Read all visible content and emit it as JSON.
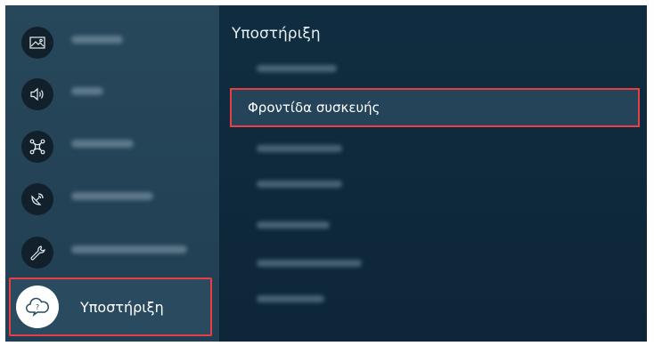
{
  "sidebar": {
    "items": [
      {
        "icon": "picture-icon"
      },
      {
        "icon": "sound-icon"
      },
      {
        "icon": "connection-icon"
      },
      {
        "icon": "broadcasting-icon"
      },
      {
        "icon": "wrench-icon"
      }
    ],
    "selected": {
      "label": "Υποστήριξη",
      "icon": "support-cloud-icon"
    }
  },
  "content": {
    "title": "Υποστήριξη",
    "selected_option": "Φροντίδα συσκευής"
  },
  "colors": {
    "highlight_border": "#e83e44",
    "sidebar_bg": "#27475b",
    "content_bg": "#102d40"
  }
}
